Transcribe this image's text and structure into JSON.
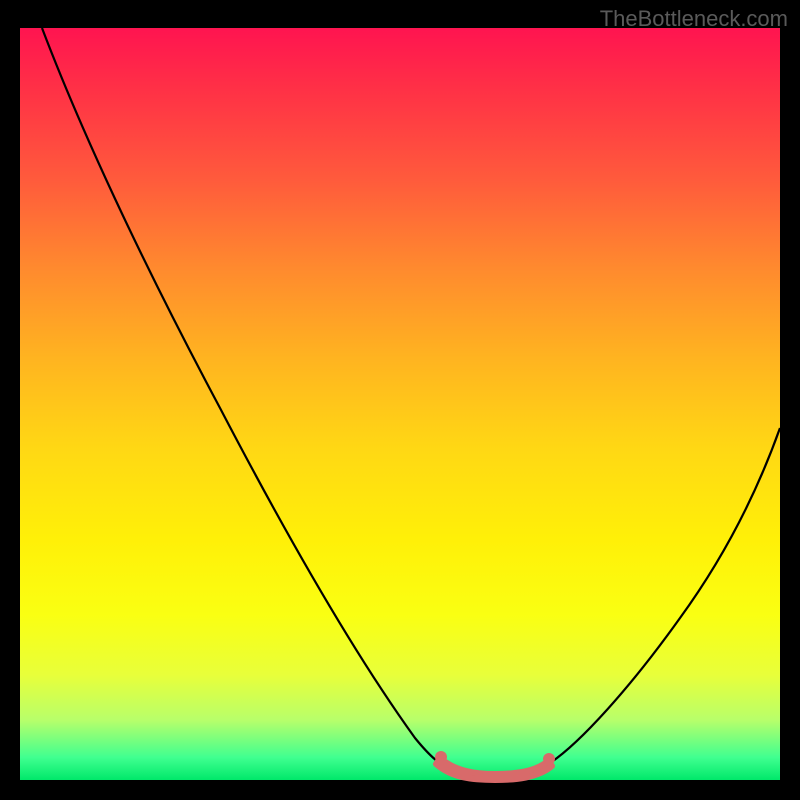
{
  "watermark": "TheBottleneck.com",
  "chart_data": {
    "type": "line",
    "title": "",
    "xlabel": "",
    "ylabel": "",
    "xlim": [
      0,
      100
    ],
    "ylim": [
      0,
      100
    ],
    "series": [
      {
        "name": "curve-left",
        "x": [
          3,
          10,
          20,
          30,
          40,
          50,
          55
        ],
        "values": [
          100,
          86,
          67,
          48,
          29,
          10,
          3
        ],
        "color": "#000000"
      },
      {
        "name": "curve-right",
        "x": [
          70,
          75,
          80,
          85,
          90,
          95,
          100
        ],
        "values": [
          4,
          9,
          15,
          22,
          30,
          38,
          47
        ],
        "color": "#000000"
      },
      {
        "name": "bottom-band",
        "x": [
          55,
          58,
          62,
          66,
          70
        ],
        "values": [
          3,
          1.5,
          1.2,
          1.5,
          3
        ],
        "color": "#d86a6a"
      }
    ],
    "annotations": []
  }
}
